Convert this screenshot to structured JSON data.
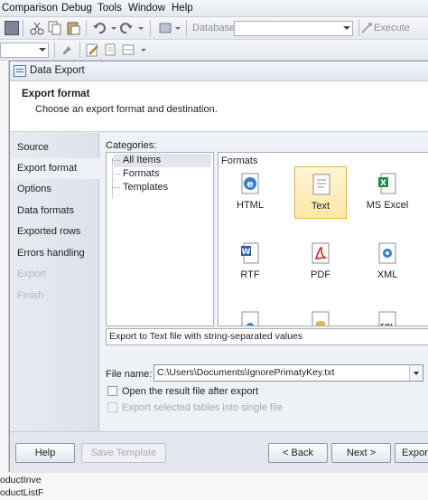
{
  "menubar": {
    "items": [
      "Comparison",
      "Debug",
      "Tools",
      "Window",
      "Help"
    ]
  },
  "toolbar": {
    "database_label": "Database",
    "execute_label": "Execute"
  },
  "background": {
    "tree_items": [
      "oductInve",
      "oductListF"
    ]
  },
  "dialog": {
    "title": "Data Export",
    "header_title": "Export format",
    "header_subtitle": "Choose an export format and destination.",
    "steps": [
      {
        "label": "Source",
        "state": "normal"
      },
      {
        "label": "Export format",
        "state": "active"
      },
      {
        "label": "Options",
        "state": "normal"
      },
      {
        "label": "Data formats",
        "state": "normal"
      },
      {
        "label": "Exported rows",
        "state": "normal"
      },
      {
        "label": "Errors handling",
        "state": "normal"
      },
      {
        "label": "Export",
        "state": "disabled"
      },
      {
        "label": "Finish",
        "state": "disabled"
      }
    ],
    "categories_label": "Categories:",
    "categories": [
      "All Items",
      "Formats",
      "Templates"
    ],
    "selected_category": "All Items",
    "formats_label": "Formats",
    "formats": [
      {
        "label": "HTML",
        "icon": "html-file-icon"
      },
      {
        "label": "Text",
        "icon": "text-file-icon"
      },
      {
        "label": "MS Excel",
        "icon": "excel-file-icon"
      },
      {
        "label": "RTF",
        "icon": "rtf-file-icon"
      },
      {
        "label": "PDF",
        "icon": "pdf-file-icon"
      },
      {
        "label": "XML",
        "icon": "xml-file-icon"
      },
      {
        "label": "",
        "icon": "document-file-icon"
      },
      {
        "label": "",
        "icon": "database-file-icon"
      },
      {
        "label": "",
        "icon": "sql-file-icon"
      }
    ],
    "selected_format": "Text",
    "description": "Export to Text file with string-separated values",
    "file_name_label": "File name:",
    "file_name_value": "C:\\Users\\Documents\\IgnorePrimatyKey.txt",
    "open_after_label": "Open the result file after export",
    "single_file_label": "Export selected tables into single file",
    "buttons": {
      "help": "Help",
      "save_template": "Save Template",
      "back": "< Back",
      "next": "Next >",
      "export": "Export"
    }
  },
  "colors": {
    "selection_fill": "#ffe7a4",
    "selection_border": "#e3b743",
    "accent": "#3a6fc0"
  }
}
